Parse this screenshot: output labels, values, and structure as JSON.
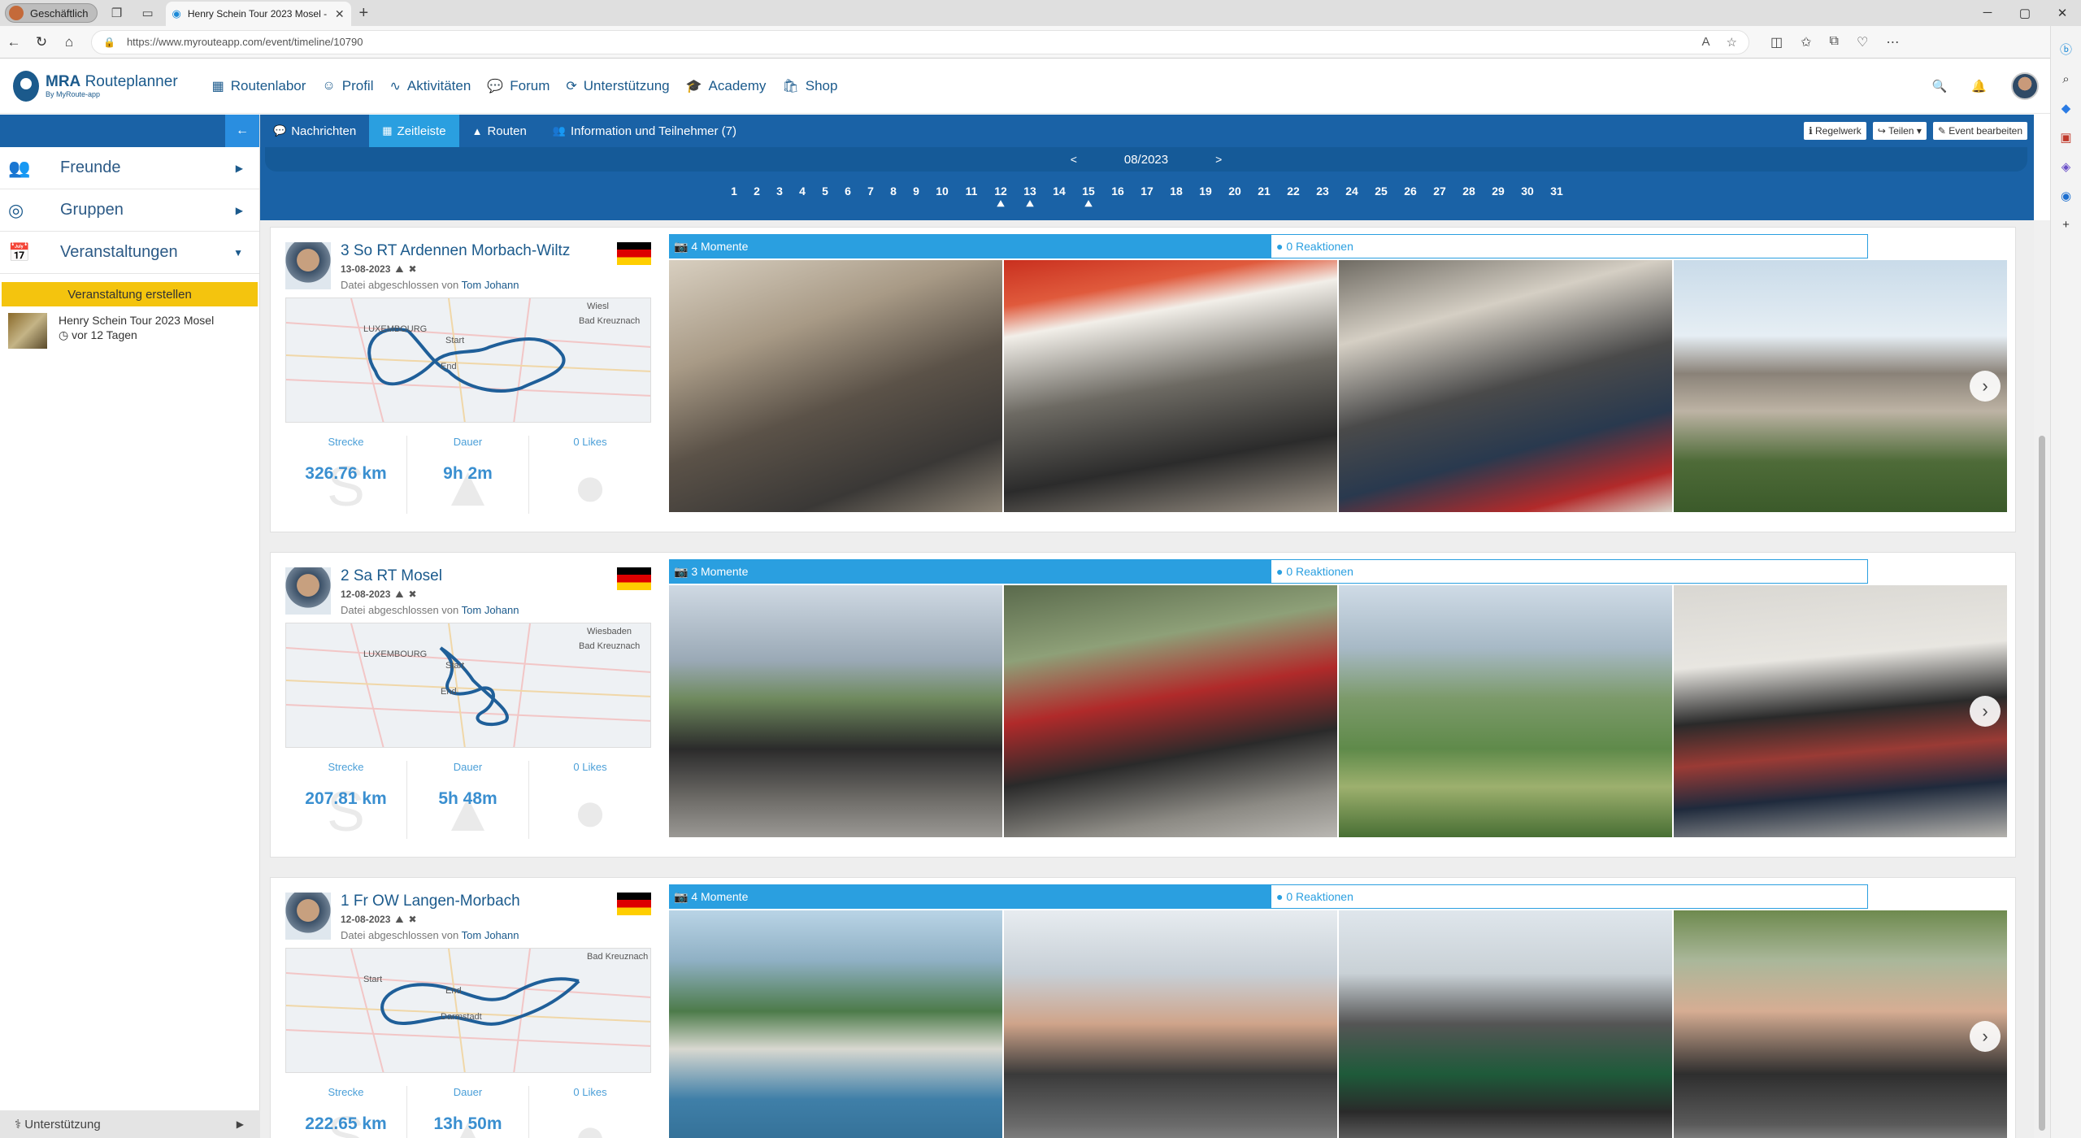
{
  "browser": {
    "profile": "Geschäftlich",
    "tab_title": "Henry Schein Tour 2023 Mosel -",
    "url": "https://www.myrouteapp.com/event/timeline/10790"
  },
  "app": {
    "logo_main": "MRA",
    "logo_rest": "Routeplanner",
    "logo_sub": "By MyRoute-app",
    "nav": [
      "Routenlabor",
      "Profil",
      "Aktivitäten",
      "Forum",
      "Unterstützung",
      "Academy",
      "Shop"
    ]
  },
  "sidebar": {
    "items": [
      {
        "label": "Freunde",
        "icon": "friends-icon"
      },
      {
        "label": "Gruppen",
        "icon": "groups-icon"
      },
      {
        "label": "Veranstaltungen",
        "icon": "calendar-icon"
      }
    ],
    "create_label": "Veranstaltung erstellen",
    "event": {
      "name": "Henry Schein Tour 2023 Mosel",
      "ago": "vor 12 Tagen"
    },
    "bottom_label": "Unterstützung"
  },
  "subnav": {
    "tabs": [
      "Nachrichten",
      "Zeitleiste",
      "Routen",
      "Information und Teilnehmer (7)"
    ],
    "active": "Zeitleiste",
    "right_buttons": [
      "Regelwerk",
      "Teilen",
      "Event bearbeiten"
    ]
  },
  "calendar": {
    "month": "08/2023",
    "prev": "<",
    "next": ">",
    "days": [
      "1",
      "2",
      "3",
      "4",
      "5",
      "6",
      "7",
      "8",
      "9",
      "10",
      "11",
      "12",
      "13",
      "14",
      "15",
      "16",
      "17",
      "18",
      "19",
      "20",
      "21",
      "22",
      "23",
      "24",
      "25",
      "26",
      "27",
      "28",
      "29",
      "30",
      "31"
    ],
    "marked_days": [
      "12",
      "13",
      "15"
    ]
  },
  "routes": [
    {
      "title": "3 So RT Ardennen Morbach-Wiltz",
      "date": "13-08-2023",
      "by_prefix": "Datei abgeschlossen von",
      "by_name": "Tom Johann",
      "stats": {
        "strecke_label": "Strecke",
        "strecke": "326.76 km",
        "dauer_label": "Dauer",
        "dauer": "9h 2m",
        "likes": "0 Likes"
      },
      "moments": "4 Momente",
      "reactions": "0 Reaktionen",
      "map_labels": [
        "LUXEMBOURG",
        "Start",
        "End",
        "Wiesl",
        "Bad Kreuznach"
      ]
    },
    {
      "title": "2 Sa RT Mosel",
      "date": "12-08-2023",
      "by_prefix": "Datei abgeschlossen von",
      "by_name": "Tom Johann",
      "stats": {
        "strecke_label": "Strecke",
        "strecke": "207.81 km",
        "dauer_label": "Dauer",
        "dauer": "5h 48m",
        "likes": "0 Likes"
      },
      "moments": "3 Momente",
      "reactions": "0 Reaktionen",
      "map_labels": [
        "LUXEMBOURG",
        "Start",
        "End",
        "Wiesbaden",
        "Bad Kreuznach"
      ]
    },
    {
      "title": "1 Fr OW Langen-Morbach",
      "date": "12-08-2023",
      "by_prefix": "Datei abgeschlossen von",
      "by_name": "Tom Johann",
      "stats": {
        "strecke_label": "Strecke",
        "strecke": "222.65 km",
        "dauer_label": "Dauer",
        "dauer": "13h 50m",
        "likes": "0 Likes"
      },
      "moments": "4 Momente",
      "reactions": "0 Reaktionen",
      "map_labels": [
        "Start",
        "End",
        "Darmstadt",
        "Bad Kreuznach"
      ]
    }
  ],
  "colors": {
    "brand": "#1b5a8c",
    "bar": "#1a62a6",
    "accent": "#2a9fe0",
    "yellow": "#f4c40e"
  }
}
